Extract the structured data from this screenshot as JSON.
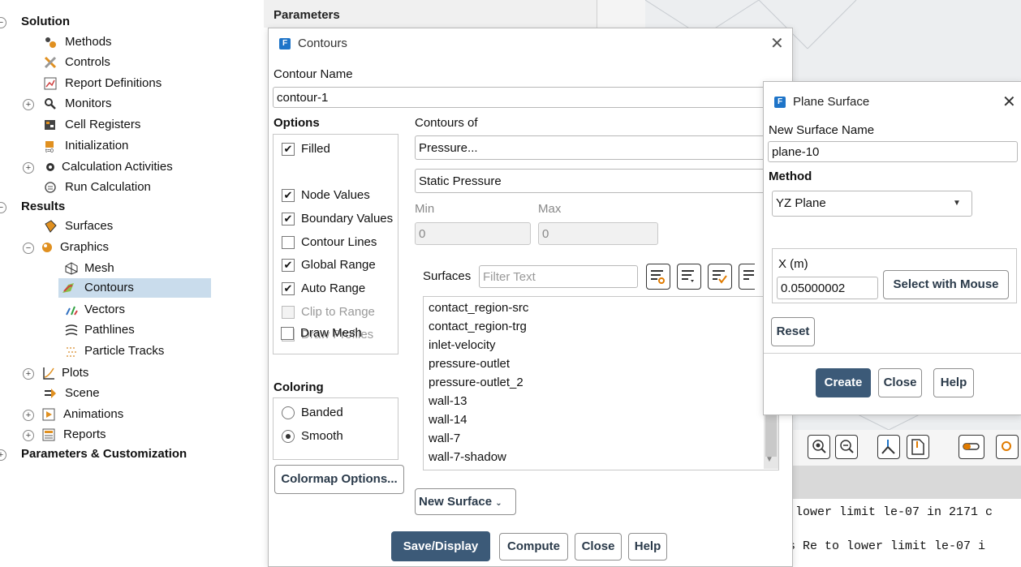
{
  "tree": {
    "items": [
      {
        "label": "Solution",
        "bold": true
      },
      {
        "label": "Methods"
      },
      {
        "label": "Controls"
      },
      {
        "label": "Report Definitions"
      },
      {
        "label": "Monitors"
      },
      {
        "label": "Cell Registers"
      },
      {
        "label": "Initialization"
      },
      {
        "label": "Calculation Activities"
      },
      {
        "label": "Run Calculation"
      },
      {
        "label": "Results",
        "bold": true
      },
      {
        "label": "Surfaces"
      },
      {
        "label": "Graphics"
      },
      {
        "label": "Mesh"
      },
      {
        "label": "Contours",
        "selected": true
      },
      {
        "label": "Vectors"
      },
      {
        "label": "Pathlines"
      },
      {
        "label": "Particle Tracks"
      },
      {
        "label": "Plots"
      },
      {
        "label": "Scene"
      },
      {
        "label": "Animations"
      },
      {
        "label": "Reports"
      },
      {
        "label": "Parameters & Customization",
        "bold": true
      }
    ]
  },
  "parameters_header": "Parameters",
  "contours_dialog": {
    "title": "Contours",
    "contour_name_label": "Contour Name",
    "contour_name_value": "contour-1",
    "options_label": "Options",
    "options": [
      {
        "label": "Filled",
        "checked": true,
        "disabled": false
      },
      {
        "label": "Node Values",
        "checked": true,
        "disabled": false
      },
      {
        "label": "Boundary Values",
        "checked": true,
        "disabled": false
      },
      {
        "label": "Contour Lines",
        "checked": false,
        "disabled": false
      },
      {
        "label": "Global Range",
        "checked": true,
        "disabled": false
      },
      {
        "label": "Auto Range",
        "checked": true,
        "disabled": false
      },
      {
        "label": "Clip to Range",
        "checked": false,
        "disabled": true
      },
      {
        "label": "Draw Profiles",
        "checked": false,
        "disabled": true
      },
      {
        "label": "Draw Mesh",
        "checked": false,
        "disabled": false
      }
    ],
    "contours_of_label": "Contours of",
    "contours_of_value": "Pressure...",
    "sub_value": "Static Pressure",
    "min_label": "Min",
    "max_label": "Max",
    "min_value": "0",
    "max_value": "0",
    "surfaces_label": "Surfaces",
    "filter_placeholder": "Filter Text",
    "surfaces": [
      "contact_region-src",
      "contact_region-trg",
      "inlet-velocity",
      "pressure-outlet",
      "pressure-outlet_2",
      "wall-13",
      "wall-14",
      "wall-7",
      "wall-7-shadow"
    ],
    "coloring_label": "Coloring",
    "coloring_options": [
      "Banded",
      "Smooth"
    ],
    "coloring_selected": "Smooth",
    "colormap_button": "Colormap Options...",
    "new_surface_button": "New Surface",
    "save_display_button": "Save/Display",
    "compute_button": "Compute",
    "close_button": "Close",
    "help_button": "Help"
  },
  "plane_dialog": {
    "title": "Plane Surface",
    "name_label": "New Surface Name",
    "name_value": "plane-10",
    "method_label": "Method",
    "method_value": "YZ Plane",
    "x_label": "X (m)",
    "x_value": "0.05000002",
    "select_mouse_button": "Select with Mouse",
    "reset_button": "Reset",
    "create_button": "Create",
    "close_button": "Close",
    "help_button": "Help"
  },
  "console": {
    "line1": "o lower limit le-07 in 2171 c",
    "line2": "ss Re to lower limit le-07 i"
  },
  "colors": {
    "primary_button": "#3c5a78",
    "selection": "#c9dcec",
    "fluent_icon": "#1e74c8"
  }
}
